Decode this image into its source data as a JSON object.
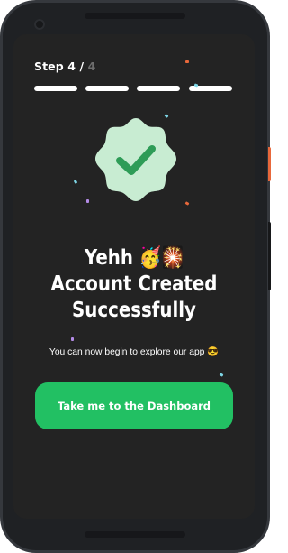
{
  "step": {
    "label": "Step 4 / ",
    "total": "4",
    "segments": 4,
    "completed": 4
  },
  "badge": {
    "icon": "check-icon",
    "badge_color": "#c8ecd2",
    "check_color": "#2e9c57"
  },
  "headline": {
    "line1": "Yehh 🥳🎇",
    "line2": "Account Created",
    "line3": "Successfully"
  },
  "subtext": "You can now begin to explore our app 😎",
  "cta": {
    "label": "Take me to the Dashboard",
    "color": "#22c063"
  },
  "colors": {
    "screen_bg": "#232323",
    "phone_frame": "#35383d",
    "text": "#ffffff",
    "muted": "#6d6d6d"
  }
}
